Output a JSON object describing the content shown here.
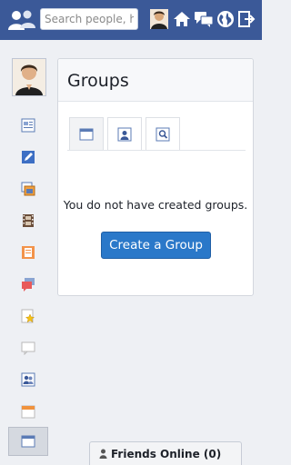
{
  "header": {
    "search_placeholder": "Search people, hashtags",
    "icons": [
      "friends-logo-icon",
      "profile-avatar-icon",
      "home-icon",
      "messages-icon",
      "globe-icon",
      "logout-icon"
    ]
  },
  "sidebar": {
    "items": [
      {
        "icon": "news-icon"
      },
      {
        "icon": "edit-icon"
      },
      {
        "icon": "photos-icon"
      },
      {
        "icon": "videos-icon"
      },
      {
        "icon": "pages-icon"
      },
      {
        "icon": "chat-icon"
      },
      {
        "icon": "favorites-icon"
      },
      {
        "icon": "comment-icon"
      },
      {
        "icon": "groups-icon"
      },
      {
        "icon": "events-icon"
      },
      {
        "icon": "window-icon",
        "active": true
      }
    ]
  },
  "panel": {
    "title": "Groups",
    "empty_message": "You do not have created groups.",
    "create_label": "Create a Group",
    "tabs": [
      "tab-window",
      "tab-profile",
      "tab-search"
    ]
  },
  "friends_online": {
    "label": "Friends Online (0)"
  },
  "colors": {
    "topbar": "#3b5998",
    "button": "#2a78c9"
  }
}
